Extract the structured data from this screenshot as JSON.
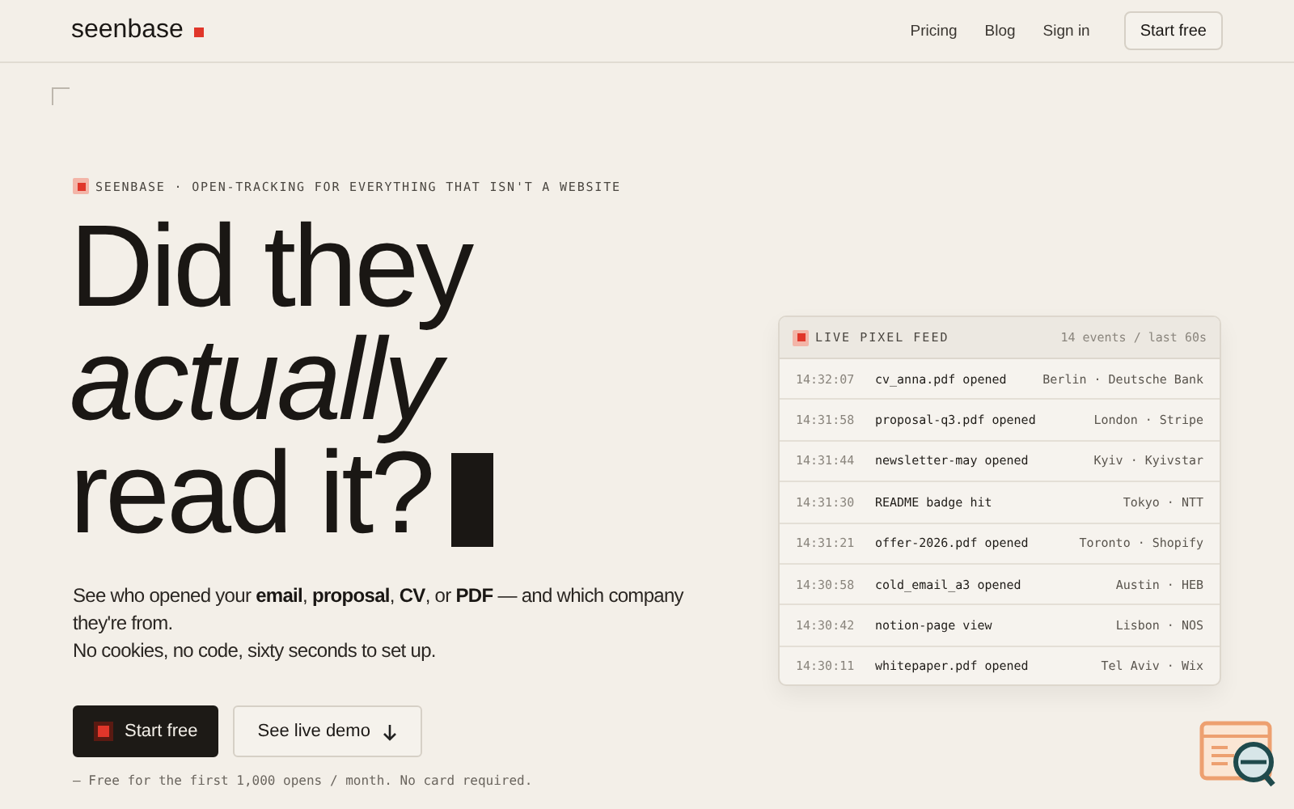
{
  "nav": {
    "logo": "seenbase",
    "links": [
      {
        "label": "Pricing"
      },
      {
        "label": "Blog"
      },
      {
        "label": "Sign in"
      }
    ],
    "cta": "Start free"
  },
  "hero": {
    "eyebrow": "SEENBASE · OPEN-TRACKING FOR EVERYTHING THAT ISN'T A WEBSITE",
    "headline": [
      {
        "text": "Did they",
        "italic": false
      },
      {
        "text": "actually",
        "italic": true
      },
      {
        "text": "read it?",
        "italic": false
      }
    ],
    "cursor": true,
    "description": "See who opened your **email**, **proposal**, **CV**, or **PDF** — and which company they're from.",
    "description_2": "No cookies, no code, sixty seconds to set up.",
    "buttons": [
      {
        "label": "Start free",
        "kind": "primary"
      },
      {
        "label": "See live demo",
        "kind": "secondary"
      }
    ],
    "footnote": "— Free for the first 1,000 opens / month. No card required."
  },
  "feed": {
    "title": "LIVE PIXEL FEED",
    "meta": "14 events / last 60s",
    "events": [
      {
        "time": "14:32:07",
        "event": "cv_anna.pdf opened",
        "location": "Berlin · Deutsche Bank"
      },
      {
        "time": "14:31:58",
        "event": "proposal-q3.pdf opened",
        "location": "London · Stripe"
      },
      {
        "time": "14:31:44",
        "event": "newsletter-may opened",
        "location": "Kyiv · Kyivstar"
      },
      {
        "time": "14:31:30",
        "event": "README badge hit",
        "location": "Tokyo · NTT"
      },
      {
        "time": "14:31:21",
        "event": "offer-2026.pdf opened",
        "location": "Toronto · Shopify"
      },
      {
        "time": "14:30:58",
        "event": "cold_email_a3 opened",
        "location": "Austin · HEB"
      },
      {
        "time": "14:30:42",
        "event": "notion-page view",
        "location": "Lisbon · NOS"
      },
      {
        "time": "14:30:11",
        "event": "whitepaper.pdf opened",
        "location": "Tel Aviv · Wix"
      }
    ]
  }
}
